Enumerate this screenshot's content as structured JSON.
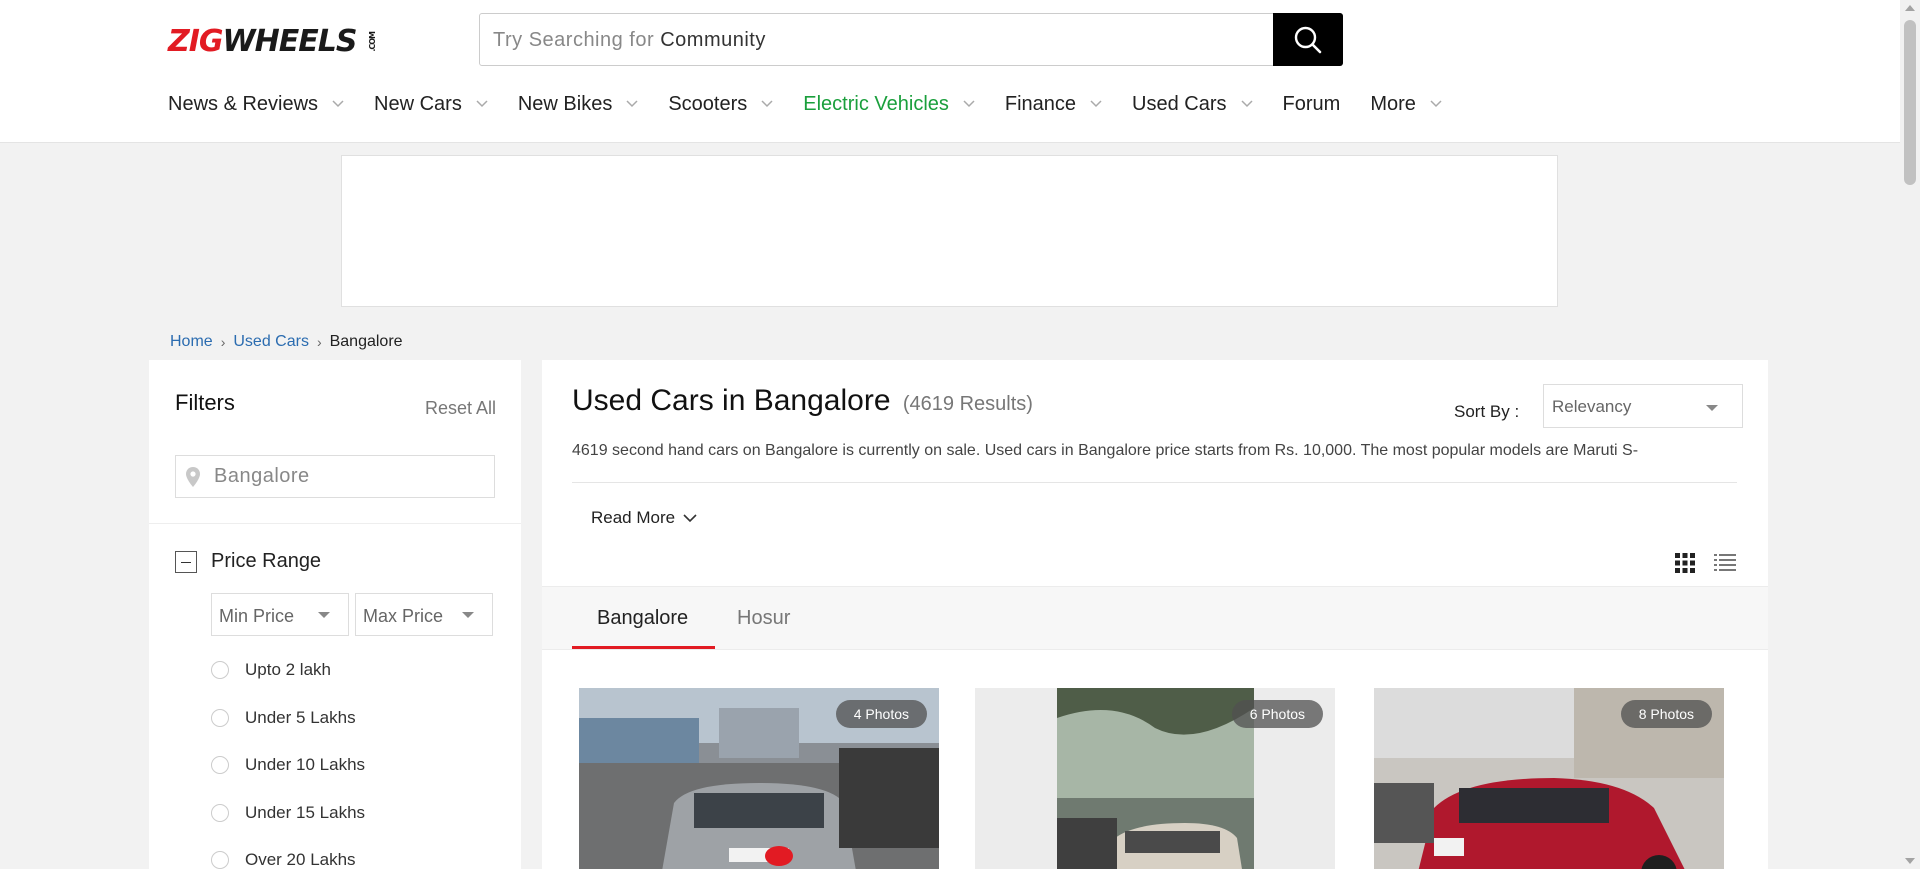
{
  "brand": {
    "name_part1": "ZIG",
    "name_part2": "WHEELS",
    "suffix": ".COM",
    "accent_color": "#e21b23"
  },
  "search": {
    "placeholder_prefix": "Try Searching for",
    "placeholder_term": "Community",
    "icon": "search-icon"
  },
  "nav": [
    {
      "label": "News & Reviews",
      "dropdown": true
    },
    {
      "label": "New Cars",
      "dropdown": true
    },
    {
      "label": "New Bikes",
      "dropdown": true
    },
    {
      "label": "Scooters",
      "dropdown": true
    },
    {
      "label": "Electric Vehicles",
      "dropdown": true,
      "color": "#1a9f3c"
    },
    {
      "label": "Finance",
      "dropdown": true
    },
    {
      "label": "Used Cars",
      "dropdown": true
    },
    {
      "label": "Forum",
      "dropdown": false
    },
    {
      "label": "More",
      "dropdown": true
    }
  ],
  "breadcrumb": {
    "home": "Home",
    "used_cars": "Used Cars",
    "current": "Bangalore"
  },
  "filters": {
    "title": "Filters",
    "reset": "Reset All",
    "location": "Bangalore",
    "price_range": {
      "title": "Price Range",
      "min_label": "Min Price",
      "max_label": "Max Price",
      "options": [
        "Upto 2 lakh",
        "Under 5 Lakhs",
        "Under 10 Lakhs",
        "Under 15 Lakhs",
        "Over 20 Lakhs"
      ]
    }
  },
  "main": {
    "title": "Used Cars in Bangalore",
    "results": "(4619 Results)",
    "sort_label": "Sort By :",
    "sort_value": "Relevancy",
    "description": "4619 second hand cars on Bangalore is currently on sale. Used cars in Bangalore price starts from Rs. 10,000. The most popular models are Maruti S-",
    "read_more": "Read More",
    "tabs": [
      "Bangalore",
      "Hosur"
    ],
    "cards": [
      {
        "photos": "4 Photos"
      },
      {
        "photos": "6 Photos"
      },
      {
        "photos": "8 Photos"
      }
    ]
  }
}
